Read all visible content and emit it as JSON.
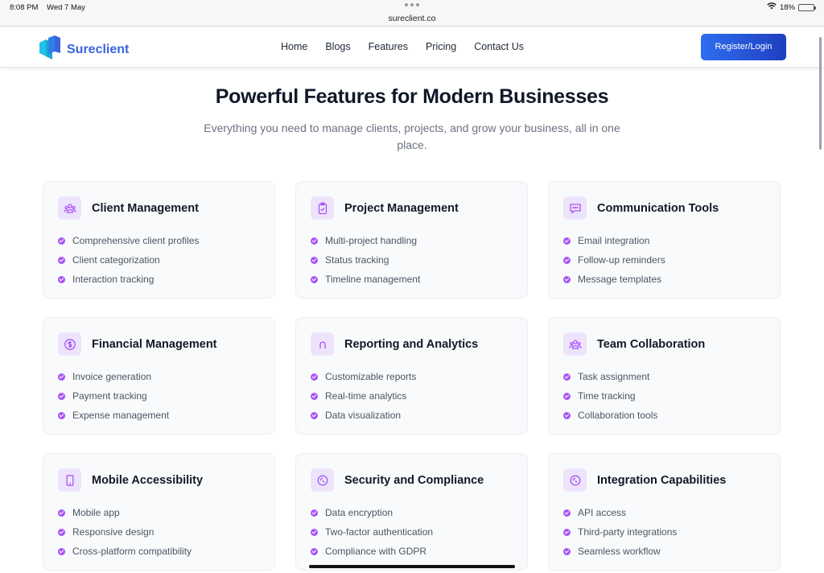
{
  "status_bar": {
    "time": "8:08 PM",
    "date": "Wed 7 May",
    "url": "sureclient.co",
    "battery": "18%",
    "battery_level": 0.18,
    "wifi_icon": "wifi-icon"
  },
  "header": {
    "logo_text": "Sureclient",
    "nav": [
      "Home",
      "Blogs",
      "Features",
      "Pricing",
      "Contact Us"
    ],
    "cta_label": "Register/Login"
  },
  "hero": {
    "title": "Powerful Features for Modern Businesses",
    "subtitle": "Everything you need to manage clients, projects, and grow your business, all in one place."
  },
  "features": [
    {
      "title": "Client Management",
      "icon": "users-icon",
      "items": [
        "Comprehensive client profiles",
        "Client categorization",
        "Interaction tracking"
      ]
    },
    {
      "title": "Project Management",
      "icon": "clipboard-icon",
      "items": [
        "Multi-project handling",
        "Status tracking",
        "Timeline management"
      ]
    },
    {
      "title": "Communication Tools",
      "icon": "chat-icon",
      "items": [
        "Email integration",
        "Follow-up reminders",
        "Message templates"
      ]
    },
    {
      "title": "Financial Management",
      "icon": "dollar-icon",
      "items": [
        "Invoice generation",
        "Payment tracking",
        "Expense management"
      ]
    },
    {
      "title": "Reporting and Analytics",
      "icon": "chart-icon",
      "items": [
        "Customizable reports",
        "Real-time analytics",
        "Data visualization"
      ]
    },
    {
      "title": "Team Collaboration",
      "icon": "team-icon",
      "items": [
        "Task assignment",
        "Time tracking",
        "Collaboration tools"
      ]
    },
    {
      "title": "Mobile Accessibility",
      "icon": "mobile-icon",
      "items": [
        "Mobile app",
        "Responsive design",
        "Cross-platform compatibility"
      ]
    },
    {
      "title": "Security and Compliance",
      "icon": "shield-icon",
      "items": [
        "Data encryption",
        "Two-factor authentication",
        "Compliance with GDPR"
      ]
    },
    {
      "title": "Integration Capabilities",
      "icon": "plug-icon",
      "items": [
        "API access",
        "Third-party integrations",
        "Seamless workflow"
      ]
    }
  ],
  "colors": {
    "brand": "#3b63e0",
    "accent": "#a855f7",
    "icon_bg": "#ede4fb",
    "cta_start": "#2f6df0",
    "cta_end": "#1e3fbf"
  }
}
